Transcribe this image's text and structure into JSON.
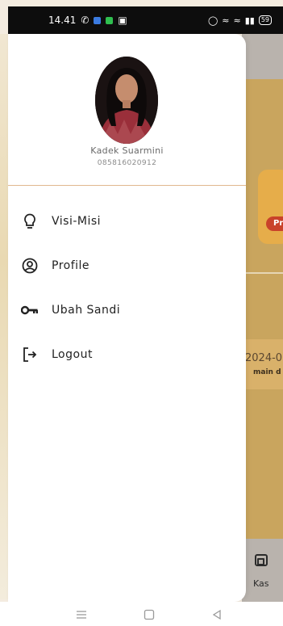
{
  "status_bar": {
    "time": "14.41",
    "battery": "59"
  },
  "drawer": {
    "user": {
      "name": "Kadek Suarmini",
      "phone": "085816020912"
    },
    "menu": [
      {
        "label": "Visi-Misi",
        "icon": "lightbulb-icon"
      },
      {
        "label": "Profile",
        "icon": "account-circle-icon"
      },
      {
        "label": "Ubah Sandi",
        "icon": "key-icon"
      },
      {
        "label": "Logout",
        "icon": "logout-icon"
      }
    ]
  },
  "background": {
    "card_pill": "Pr",
    "date_text": "2024-0",
    "date_sub": "main d",
    "bottom_nav_label": "Kas"
  },
  "colors": {
    "accent_divider": "#e0b88f",
    "background_main": "#c9a55e",
    "card": "#e6ad4a"
  }
}
